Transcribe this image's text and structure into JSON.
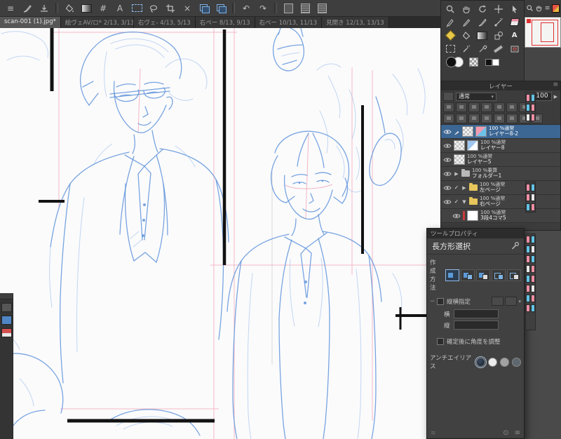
{
  "toolbar": {
    "icon_names": [
      "main-menu",
      "brush",
      "import",
      "fill-bucket",
      "gradient",
      "decoration",
      "text",
      "select-marquee",
      "lasso",
      "crop",
      "delete",
      "copy",
      "paste",
      "undo",
      "redo",
      "page-single",
      "page-facing",
      "page-grid"
    ]
  },
  "tabs": [
    {
      "label": "scan-001 (1).jpg*",
      "active": true
    },
    {
      "label": "絵ヴェAV/ロ* 2/13, 3/13",
      "active": false
    },
    {
      "label": "右ヴェ- 4/13, 5/13",
      "active": false
    },
    {
      "label": "右ペー 8/13, 9/13",
      "active": false
    },
    {
      "label": "右ペー 10/13, 11/13",
      "active": false
    },
    {
      "label": "見開き 12/13, 13/13",
      "active": false
    }
  ],
  "toolbox": {
    "tool_names": [
      "zoom",
      "hand",
      "rotate",
      "move",
      "object",
      "pen",
      "pencil",
      "brush",
      "airbrush",
      "eraser",
      "decoration",
      "fill",
      "gradient",
      "figure",
      "text",
      "selection",
      "wand",
      "eyedropper",
      "ruler",
      "navigate"
    ]
  },
  "layers": {
    "title": "レイヤー",
    "blend_mode": "通常",
    "opacity": "100",
    "items": [
      {
        "info": "100 %通常",
        "name": "レイヤー8-2"
      },
      {
        "info": "100 %通常",
        "name": "レイヤー8"
      },
      {
        "info": "100 %通常",
        "name": "レイヤー5"
      },
      {
        "info": "100 %乗算",
        "name": "フォルダー1"
      },
      {
        "info": "100 %通常",
        "name": "左ページ"
      },
      {
        "info": "100 %通常",
        "name": "右ページ"
      },
      {
        "info": "100 %通常",
        "name": "3段4コマ5"
      }
    ]
  },
  "tool_property": {
    "title": "ツールプロパティ",
    "tool_name": "長方形選択",
    "creation_label": "作成方法",
    "aspect_label": "縦横指定",
    "width_label": "横",
    "height_label": "縦",
    "width_value": "",
    "height_value": "",
    "angle_label": "確定後に角度を調整",
    "antialias_label": "アンチエイリアス"
  },
  "icons": {
    "menu": "≡",
    "close": "×",
    "dropdown": "▾",
    "tri_right": "▶",
    "tri_down": "▼",
    "check": "✓",
    "undo": "↶",
    "redo": "↷",
    "text_tool": "A",
    "gear": "⊙",
    "grip": "≡",
    "minus": "−",
    "hash": "#"
  },
  "colors": {
    "sketch_blue": "#6094da",
    "guide_pink": "#f3b0bd",
    "frame_black": "#121212",
    "selection_blue": "#3c6693",
    "chip_pink": "#ef8fa4",
    "chip_cyan": "#62c4e6",
    "folder_yellow": "#e6c65c",
    "navigator_red": "#e03030"
  }
}
